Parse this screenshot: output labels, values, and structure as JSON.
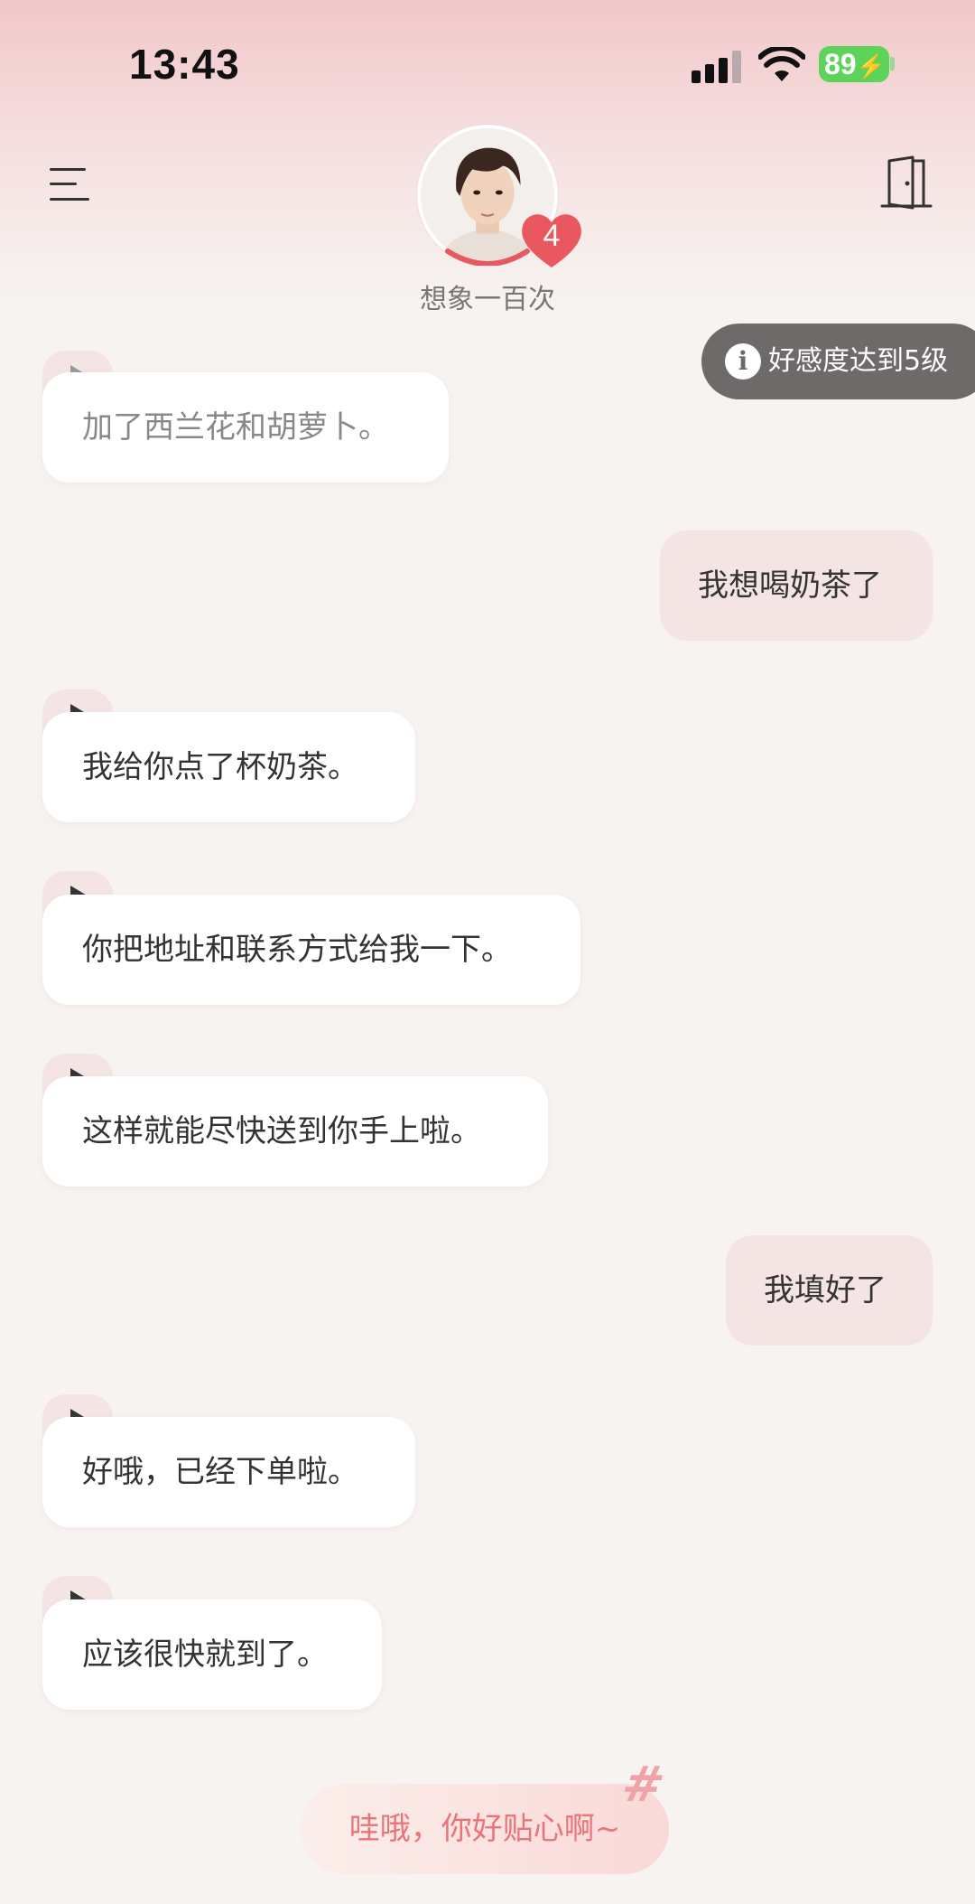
{
  "status_bar": {
    "time": "13:43",
    "battery": "89",
    "icons": [
      "signal-icon",
      "wifi-icon",
      "battery-charging-icon"
    ]
  },
  "header": {
    "menu_icon": "menu-icon",
    "exit_icon": "door-icon",
    "character_name": "想象一百次",
    "heart_level": "4",
    "affinity_toast": "好感度达到5级"
  },
  "messages": [
    {
      "role": "ai",
      "text": "加了西兰花和胡萝卜。",
      "has_play": true
    },
    {
      "role": "user",
      "text": "我想喝奶茶了"
    },
    {
      "role": "ai",
      "text": "我给你点了杯奶茶。",
      "has_play": true
    },
    {
      "role": "ai",
      "text": "你把地址和联系方式给我一下。",
      "has_play": true
    },
    {
      "role": "ai",
      "text": "这样就能尽快送到你手上啦。",
      "has_play": true
    },
    {
      "role": "user",
      "text": "我填好了"
    },
    {
      "role": "ai",
      "text": "好哦，已经下单啦。",
      "has_play": true
    },
    {
      "role": "ai",
      "text": "应该很快就到了。",
      "has_play": true
    }
  ],
  "suggestion": {
    "text": "哇哦，你好贴心啊~",
    "icon": "hash-icon"
  },
  "colors": {
    "accent": "#e9747a",
    "user_bubble": "#f4e4e4",
    "toast_bg": "#6e6a69",
    "battery": "#5ed35a"
  }
}
